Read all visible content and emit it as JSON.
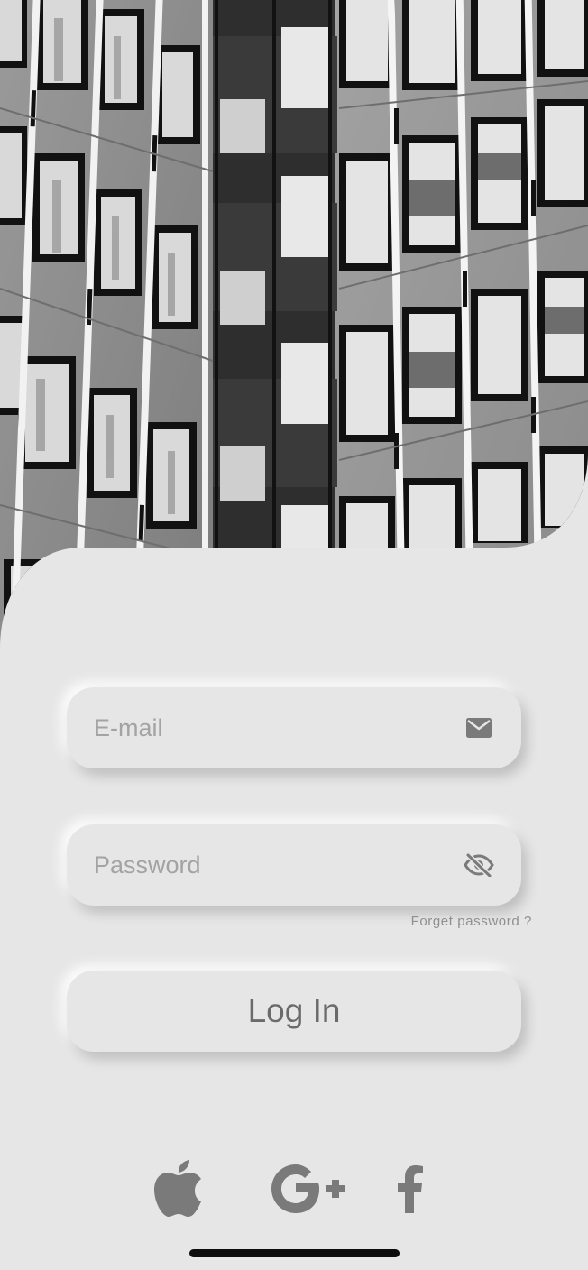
{
  "hero": {
    "image": "black-and-white-office-building-facade"
  },
  "login_form": {
    "email": {
      "placeholder": "E-mail",
      "value": "",
      "icon": "envelope-icon"
    },
    "password": {
      "placeholder": "Password",
      "value": "",
      "icon": "eye-off-icon"
    },
    "forgot_password_label": "Forget password ?",
    "login_button_label": "Log In"
  },
  "social_login": [
    {
      "name": "apple",
      "icon": "apple-icon"
    },
    {
      "name": "google-plus",
      "icon": "google-plus-icon"
    },
    {
      "name": "facebook",
      "icon": "facebook-icon"
    }
  ],
  "colors": {
    "background": "#e6e6e6",
    "icon_gray": "#7a7a7a",
    "placeholder_gray": "#a3a3a3",
    "button_text": "#6a6a6a"
  }
}
